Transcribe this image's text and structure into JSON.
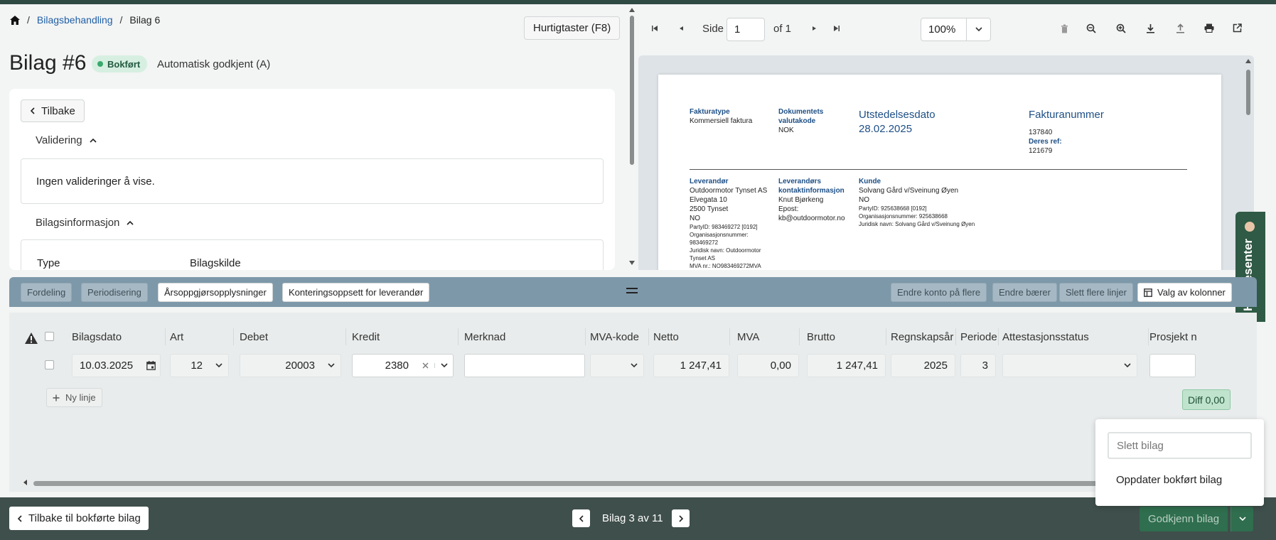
{
  "breadcrumb": {
    "home_icon": "home-icon",
    "items": [
      "Bilagsbehandling",
      "Bilag 6"
    ]
  },
  "header": {
    "shortcut_label": "Hurtigtaster (F8)",
    "title": "Bilag #6",
    "status_badge": "Bokført",
    "auto_status": "Automatisk godkjent (A)"
  },
  "card": {
    "back_label": "Tilbake",
    "validation_title": "Validering",
    "validation_empty": "Ingen valideringer å vise.",
    "info_title": "Bilagsinformasjon",
    "type_label": "Type",
    "source_label": "Bilagskilde"
  },
  "pdf": {
    "page_label": "Side",
    "page_value": "1",
    "of_label": "of 1",
    "zoom": "100%",
    "doc": {
      "fakturatype_lbl": "Fakturatype",
      "fakturatype_val": "Kommersiell faktura",
      "valuta_lbl1": "Dokumentets",
      "valuta_lbl2": "valutakode",
      "valuta_val": "NOK",
      "utst_lbl": "Utstedelsesdato",
      "utst_val": "28.02.2025",
      "fnr_lbl": "Fakturanummer",
      "fnr_val": "137840",
      "ref_lbl": "Deres ref:",
      "ref_val": "121679",
      "lev_lbl": "Leverandør",
      "lev_name": "Outdoormotor Tynset AS",
      "lev_addr": "Elvegata 10",
      "lev_post": "2500  Tynset",
      "lev_country": "NO",
      "lev_party": "PartyID:  983469272  [0192]",
      "lev_org_lbl": "Organisasjonsnummer:",
      "lev_org_val": "983469272",
      "lev_jur1": "Juridisk navn:  Outdoormotor",
      "lev_jur2": "Tynset AS",
      "lev_mva": "MVA nr.:  NO983469272MVA",
      "kontakt_lbl1": "Leverandørs",
      "kontakt_lbl2": "kontaktinformasjon",
      "kontakt_name": "Knut Bjørkeng",
      "kontakt_epost_lbl": "Epost:",
      "kontakt_epost": "kb@outdoormotor.no",
      "kunde_lbl": "Kunde",
      "kunde_name": "Solvang Gård v/Sveinung Øyen",
      "kunde_country": "NO",
      "kunde_party": "PartyID:  925638668  [0192]",
      "kunde_org": "Organisasjonsnummer:   925638668",
      "kunde_jur": "Juridisk navn:  Solvang Gård v/Sveinung Øyen"
    }
  },
  "help_tab": "Hjelpesenter",
  "actionbar": {
    "left": [
      "Fordeling",
      "Periodisering",
      "Årsoppgjørsopplysninger",
      "Konteringsoppsett for leverandør"
    ],
    "right": [
      "Endre konto på flere",
      "Endre bærer",
      "Slett flere linjer"
    ],
    "columns_label": "Valg av kolonner"
  },
  "grid": {
    "headers": [
      "Bilagsdato",
      "Art",
      "Debet",
      "Kredit",
      "Merknad",
      "MVA-kode",
      "Netto",
      "MVA",
      "Brutto",
      "Regnskapsår",
      "Periode",
      "Attestasjonsstatus",
      "Prosjekt n"
    ],
    "row": {
      "bilagsdato": "10.03.2025",
      "art": "12",
      "debet": "20003",
      "kredit": "2380",
      "merknad": "",
      "mva_kode": "",
      "netto": "1 247,41",
      "mva": "0,00",
      "brutto": "1 247,41",
      "regnskapsar": "2025",
      "periode": "3",
      "attestasjonsstatus": "",
      "prosjekt": ""
    },
    "new_line_label": "Ny linje",
    "diff_label": "Diff 0,00"
  },
  "menu": {
    "delete_label": "Slett bilag",
    "update_label": "Oppdater bokført bilag"
  },
  "footer": {
    "back_label": "Tilbake til bokførte bilag",
    "pager_text": "Bilag 3 av 11",
    "approve_label": "Godkjenn bilag"
  }
}
